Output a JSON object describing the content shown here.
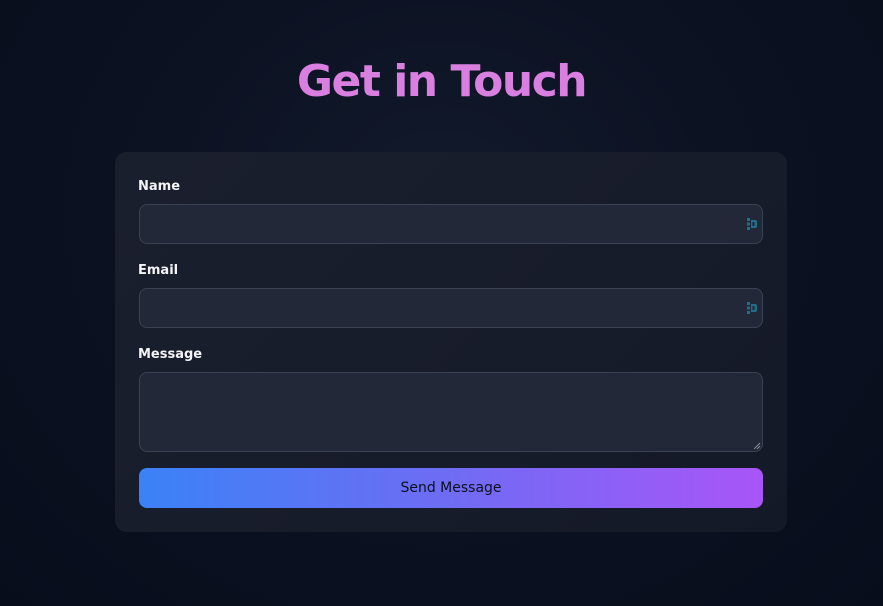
{
  "page": {
    "title": "Get in Touch"
  },
  "form": {
    "name": {
      "label": "Name",
      "value": "",
      "placeholder": ""
    },
    "email": {
      "label": "Email",
      "value": "",
      "placeholder": ""
    },
    "message": {
      "label": "Message",
      "value": "",
      "placeholder": ""
    },
    "submit_label": "Send Message"
  },
  "icons": {
    "field_autofill": "autofill-icon",
    "textarea_resize": "resize-grip-icon"
  },
  "colors": {
    "title": "#d97fe0",
    "button_gradient_start": "#3b82f6",
    "button_gradient_end": "#a855f7",
    "card_background": "#1a1f2e",
    "page_background": "#0a0f1e"
  }
}
